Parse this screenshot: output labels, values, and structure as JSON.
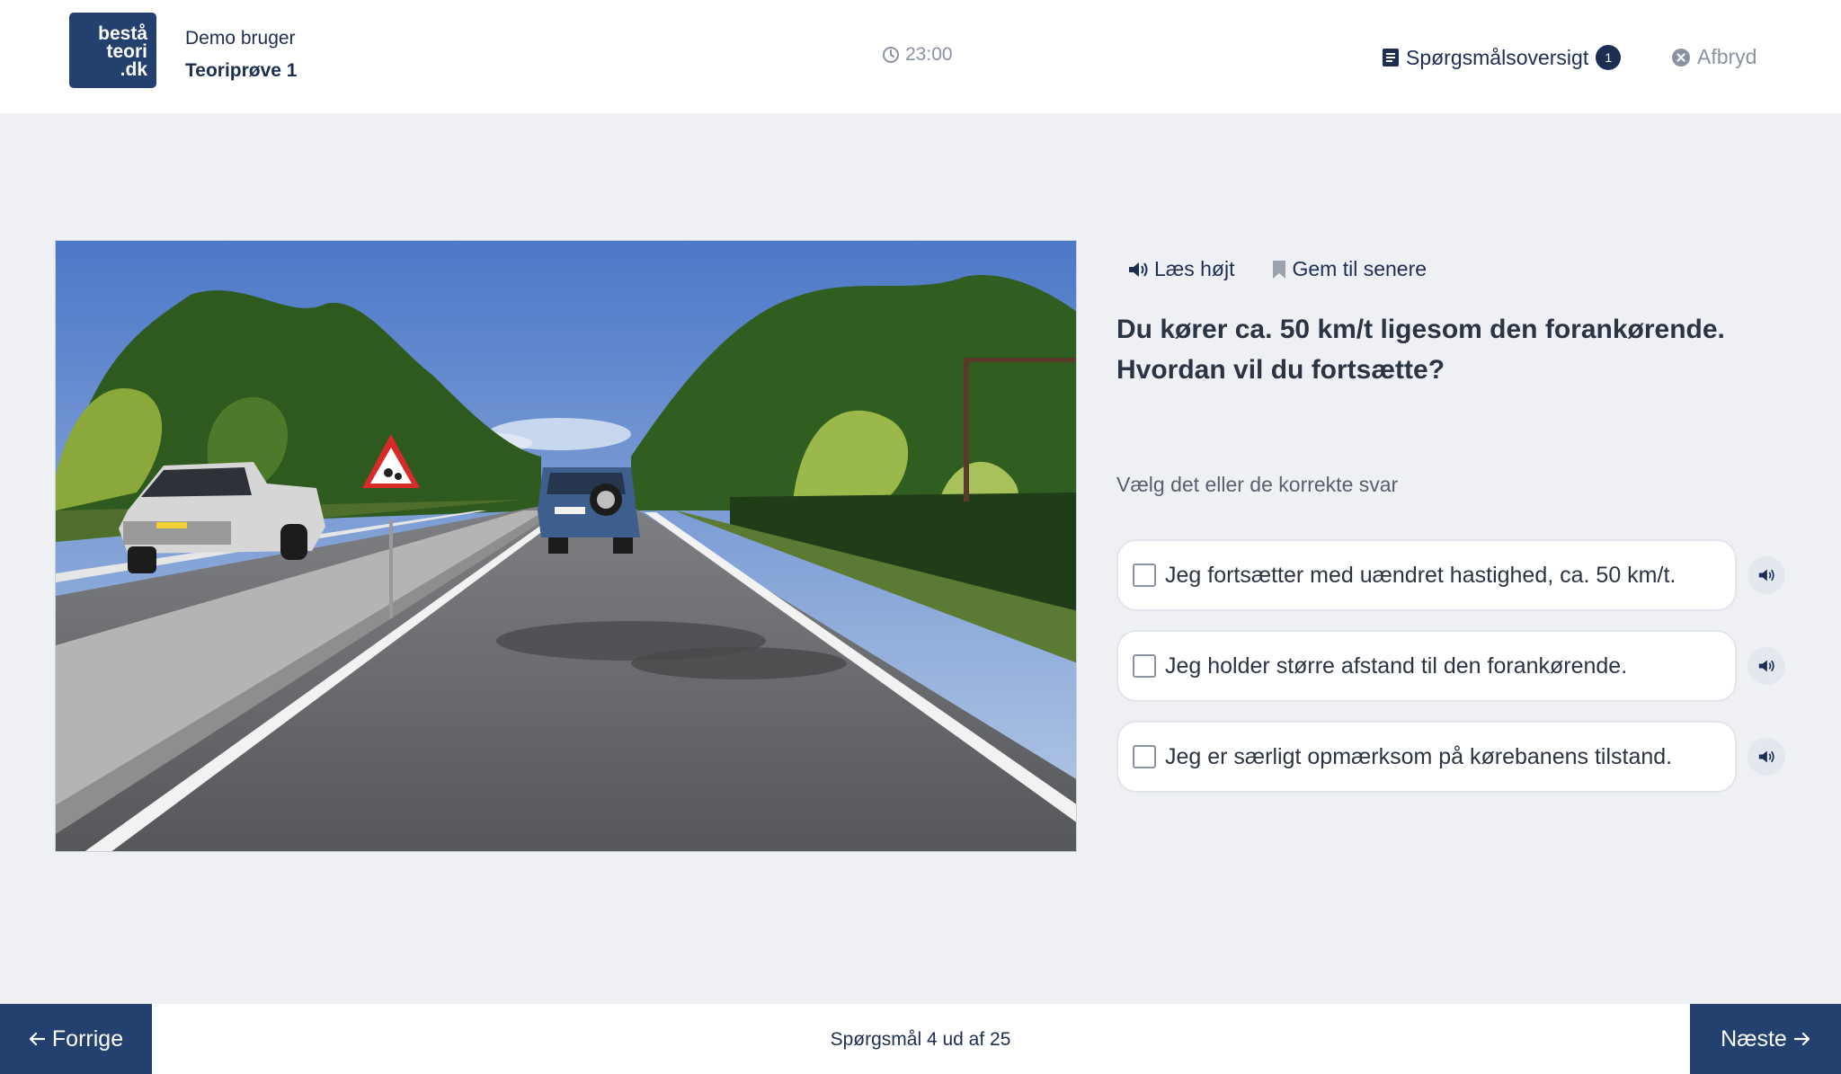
{
  "header": {
    "logo_lines": [
      "beståteori",
      ".dk"
    ],
    "logo_line1": "bestå",
    "logo_line2": "teori",
    "logo_line3": ".dk",
    "user_name": "Demo bruger",
    "exam_title": "Teoriprøve 1",
    "timer": "23:00",
    "overview_label": "Spørgsmålsoversigt",
    "overview_badge": "1",
    "abort_label": "Afbryd"
  },
  "tools": {
    "read_aloud": "Læs højt",
    "save_later": "Gem til senere"
  },
  "question": {
    "text": "Du kører ca. 50 km/t ligesom den forankørende. Hvordan vil du fortsætte?",
    "instruction": "Vælg det eller de korrekte svar",
    "answers": [
      {
        "label": "Jeg fortsætter med uændret hastighed, ca. 50 km/t.",
        "checked": false
      },
      {
        "label": "Jeg holder større afstand til den forankørende.",
        "checked": false
      },
      {
        "label": "Jeg er særligt opmærksom på kørebanens tilstand.",
        "checked": false
      }
    ]
  },
  "footer": {
    "prev_label": "Forrige",
    "next_label": "Næste",
    "progress": "Spørgsmål 4 ud af 25"
  },
  "colors": {
    "primary": "#23406f",
    "background": "#eef0f4",
    "muted": "#8a93a3"
  }
}
